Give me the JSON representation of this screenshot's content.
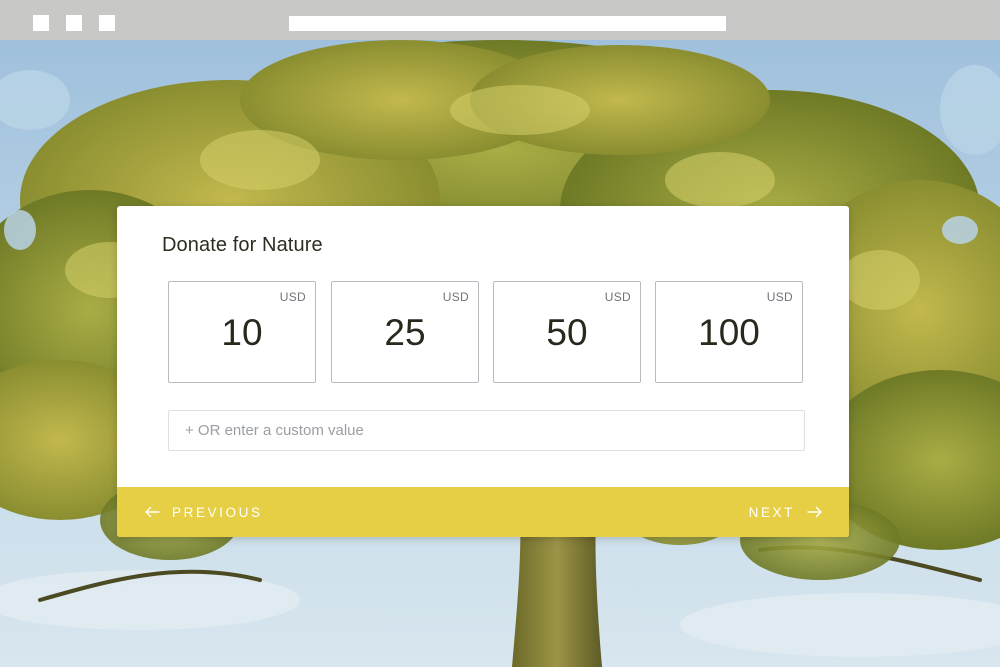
{
  "card": {
    "title": "Donate for Nature",
    "amounts": [
      {
        "value": "10",
        "currency": "USD"
      },
      {
        "value": "25",
        "currency": "USD"
      },
      {
        "value": "50",
        "currency": "USD"
      },
      {
        "value": "100",
        "currency": "USD"
      }
    ],
    "custom_placeholder": "+ OR enter a custom value",
    "previous_label": "PREVIOUS",
    "next_label": "NEXT"
  },
  "colors": {
    "footer": "#e6cf44",
    "chrome": "#c8c8c6",
    "sky": "#b9d3e6",
    "foliage": "#7f8a2e"
  },
  "icons": {
    "previous": "arrow-left-icon",
    "next": "arrow-right-icon"
  }
}
